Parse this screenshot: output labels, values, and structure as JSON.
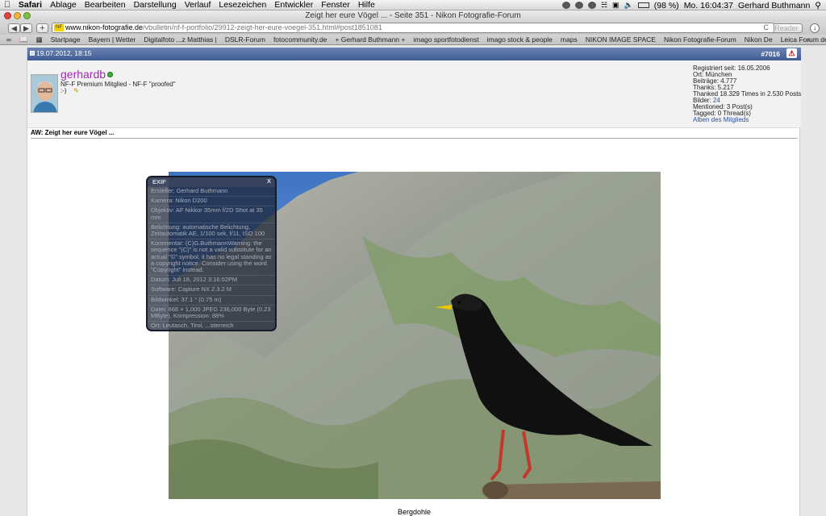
{
  "menubar": {
    "apple": "",
    "items": [
      "Safari",
      "Ablage",
      "Bearbeiten",
      "Darstellung",
      "Verlauf",
      "Lesezeichen",
      "Entwickler",
      "Fenster",
      "Hilfe"
    ],
    "battery": "(98 %)",
    "clock": "Mo. 16:04:37",
    "user": "Gerhard Buthmann"
  },
  "window": {
    "title": "Zeigt her eure Vögel ... - Seite 351 - Nikon Fotografie-Forum"
  },
  "toolbar": {
    "back": "◀",
    "forward": "▶",
    "add": "+",
    "url_badge": "NF",
    "url_host": "www.nikon-fotografie.de",
    "url_path": "/vbulletin/nf-f-portfolio/29912-zeigt-her-eure-voegel-351.html#post1851081",
    "reload": "C",
    "reader": "Reader"
  },
  "bookmarks": [
    "Startpage",
    "Bayern | Wetter",
    "Digitalfoto ...z Matthias |",
    "DSLR-Forum",
    "fotocommunity.de",
    "+ Gerhard Buthmann +",
    "imago sportfotodienst",
    "imago stock & people",
    "maps",
    "NIKON IMAGE SPACE",
    "Nikon Fotografie-Forum",
    "Nikon De",
    "Leica Forum deutsch"
  ],
  "post": {
    "date": "19.07.2012, 18:15",
    "number": "#7016",
    "username": "gerhardb",
    "usertitle": "NF-F Premium Mitglied - NF-F \"proofed\"",
    "mood": ":-)",
    "stats": {
      "registered": "Registriert seit: 16.05.2006",
      "location": "Ort: München",
      "posts": "Beiträge: 4.777",
      "thanks": "Thanks: 5.217",
      "thanked": "Thanked 18.329 Times in 2.530 Posts",
      "images_label": "Bilder:",
      "images_count": "24",
      "mentioned": "Mentioned: 3 Post(s)",
      "tagged": "Tagged: 0 Thread(s)",
      "albums": "Alben des Mitglieds"
    },
    "title": "AW: Zeigt her eure Vögel ...",
    "caption": "Bergdohle"
  },
  "exif": {
    "heading": "EXIF",
    "close": "X",
    "lines": [
      "Ersteller: Gerhard Buthmann",
      "Kamera: Nikon D200",
      "Objektiv: AF Nikkor 35mm f/2D Shot at 35 mm",
      "Belichtung: automatische Belichtung, Zeitautomatik AE, 1/100 sek, f/11, ISO 100",
      "Kommentar: (C)G.ButhmannWarning: the sequence \"(C)\" is not a valid substitute for an actual \"©\" symbol, it has no legal standing as a copyright notice. Consider using the word \"Copyright\" instead.",
      "Datum: Juli 18, 2012 3:16:02PM",
      "Software: Capture NX 2.3.2 M",
      "Bildwinkel: 37.1 ° (0.75 m)",
      "Datei: 666 × 1,000 JPEG 236,000 Byte (0.23 MByte), Kompression: 88%",
      "Ort: Leutasch, Tirol, ...sterreich"
    ]
  },
  "colors": {
    "post_header": "#4a66a0",
    "username": "#9e2bb0",
    "link": "#3050a0",
    "online": "#3cb43c"
  }
}
